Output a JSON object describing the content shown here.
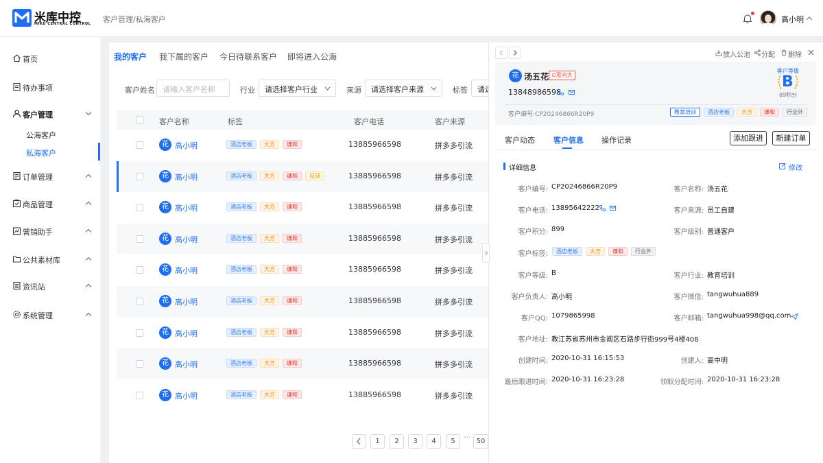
{
  "header": {
    "logo_name": "米库中控",
    "logo_sub": "MIKU CENTRAL CONTROL",
    "breadcrumb": "客户管理/私海客户",
    "user_name": "高小明"
  },
  "sidebar": {
    "home": "首页",
    "todo": "待办事项",
    "customer": "客户管理",
    "public_customer": "公海客户",
    "private_customer": "私海客户",
    "order": "订单管理",
    "product": "商品管理",
    "marketing": "营销助手",
    "material": "公共素材库",
    "news": "资讯站",
    "system": "系统管理"
  },
  "tabs": [
    "我的客户",
    "我下属的客户",
    "今日待联系客户",
    "即将进入公海"
  ],
  "filters": {
    "name_label": "客户姓名",
    "name_placeholder": "请输入客户名称",
    "industry_label": "行业",
    "industry_value": "请选择客户行业",
    "source_label": "来源",
    "source_value": "请选择客户来源",
    "tag_label": "标签",
    "tag_value": "请选"
  },
  "table": {
    "columns": [
      "客户名称",
      "标签",
      "客户电话",
      "客户来源"
    ],
    "rows": [
      {
        "avatar": "花",
        "name": "高小明",
        "tags": [
          "酒店老板",
          "大方",
          "谦和"
        ],
        "phone": "13885966598",
        "source": "拼多多引流"
      },
      {
        "avatar": "花",
        "name": "高小明",
        "tags": [
          "酒店老板",
          "大方",
          "谦和",
          "足球"
        ],
        "phone": "13885966598",
        "source": "拼多多引流"
      },
      {
        "avatar": "花",
        "name": "高小明",
        "tags": [
          "酒店老板",
          "大方",
          "谦和"
        ],
        "phone": "13885966598",
        "source": "拼多多引流"
      },
      {
        "avatar": "花",
        "name": "高小明",
        "tags": [
          "酒店老板",
          "大方",
          "谦和"
        ],
        "phone": "13885966598",
        "source": "拼多多引流"
      },
      {
        "avatar": "花",
        "name": "高小明",
        "tags": [
          "酒店老板",
          "大方",
          "谦和"
        ],
        "phone": "13885966598",
        "source": "拼多多引流"
      },
      {
        "avatar": "花",
        "name": "高小明",
        "tags": [
          "酒店老板",
          "大方",
          "谦和"
        ],
        "phone": "13885966598",
        "source": "拼多多引流"
      },
      {
        "avatar": "花",
        "name": "高小明",
        "tags": [
          "酒店老板",
          "大方",
          "谦和"
        ],
        "phone": "13885966598",
        "source": "拼多多引流"
      },
      {
        "avatar": "花",
        "name": "高小明",
        "tags": [
          "酒店老板",
          "大方",
          "谦和"
        ],
        "phone": "13885966598",
        "source": "拼多多引流"
      },
      {
        "avatar": "花",
        "name": "高小明",
        "tags": [
          "酒店老板",
          "大方",
          "谦和"
        ],
        "phone": "13885966598",
        "source": "拼多多引流"
      }
    ]
  },
  "pagination": {
    "pages": [
      "1",
      "2",
      "3",
      "4",
      "5"
    ],
    "ellipsis": "···",
    "last": "50"
  },
  "drawer": {
    "actions": [
      "放入公池",
      "分配",
      "删除"
    ],
    "customer": {
      "avatar": "花",
      "name": "汤五花",
      "intent": "意向大",
      "phone": "13848986598",
      "number": "客户编号:CP20246866R20P9",
      "tags": [
        "教育培训",
        "酒店老板",
        "大方",
        "谦和",
        "行业外"
      ],
      "level_label": "客户等级",
      "level": "B",
      "points": "89积分"
    },
    "tabs": [
      "客户动态",
      "客户信息",
      "操作记录"
    ],
    "buttons": {
      "follow": "添加跟进",
      "new_order": "新建订单"
    },
    "section_title": "详细信息",
    "edit": "修改",
    "fields": {
      "no_k": "客户编号:",
      "no_v": "CP20246866R20P9",
      "name_k": "客户名称:",
      "name_v": "汤五花",
      "tel_k": "客户电话:",
      "tel_v": "13895642222",
      "src_k": "客户来源:",
      "src_v": "员工自建",
      "pts_k": "客户积分:",
      "pts_v": "899",
      "lvl_k": "客户级别:",
      "lvl_v": "普通客户",
      "tag_k": "客户标签:",
      "tags": [
        "酒店老板",
        "大方",
        "谦和",
        "行业外"
      ],
      "grade_k": "客户等级:",
      "grade_v": "B",
      "ind_k": "客户行业:",
      "ind_v": "教育培训",
      "owner_k": "客户负责人:",
      "owner_v": "高小明",
      "wx_k": "客户微信:",
      "wx_v": "tangwuhua889",
      "qq_k": "客户QQ:",
      "qq_v": "1079865998",
      "mail_k": "客户邮箱:",
      "mail_v": "tangwuhua998@qq.com",
      "addr_k": "客户地址:",
      "addr_v": "教江苏省苏州市金阊区石路步行街999号4楼408",
      "ctime_k": "创建时间:",
      "ctime_v": "2020-10-31 16:15:53",
      "creator_k": "创建人:",
      "creator_v": "高中明",
      "last_k": "最后跟进时间:",
      "last_v": "2020-10-31 16:23:28",
      "claim_k": "领取分配时间:",
      "claim_v": "2020-10-31 16:23:28"
    }
  },
  "colors": {
    "accent": "#1e6ff1",
    "danger": "#f23a3a"
  }
}
